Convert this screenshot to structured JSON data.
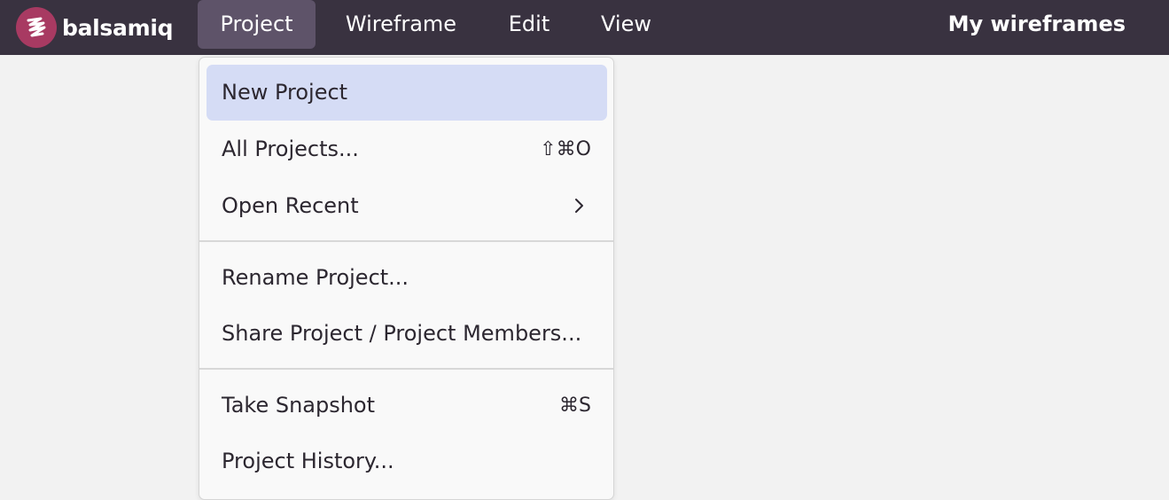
{
  "app": {
    "logo_text": "balsamiq",
    "brand_color": "#a83a62",
    "topbar_color": "#393240",
    "logo_icon": "balsamiq-logo-icon"
  },
  "menubar": {
    "items": [
      {
        "label": "Project",
        "active": true
      },
      {
        "label": "Wireframe"
      },
      {
        "label": "Edit"
      },
      {
        "label": "View"
      }
    ],
    "right_label": "My wireframes"
  },
  "project_menu": {
    "highlight_color": "#d5dcf5",
    "items": [
      {
        "label": "New Project",
        "shortcut": ""
      },
      {
        "label": "All Projects...",
        "shortcut": "⇧⌘O"
      },
      {
        "label": "Open Recent",
        "submenu_icon": "chevron-right-icon"
      },
      {
        "label": "Rename Project..."
      },
      {
        "label": "Share Project / Project Members..."
      },
      {
        "label": "Take Snapshot",
        "shortcut": "⌘S"
      },
      {
        "label": "Project History..."
      }
    ]
  }
}
